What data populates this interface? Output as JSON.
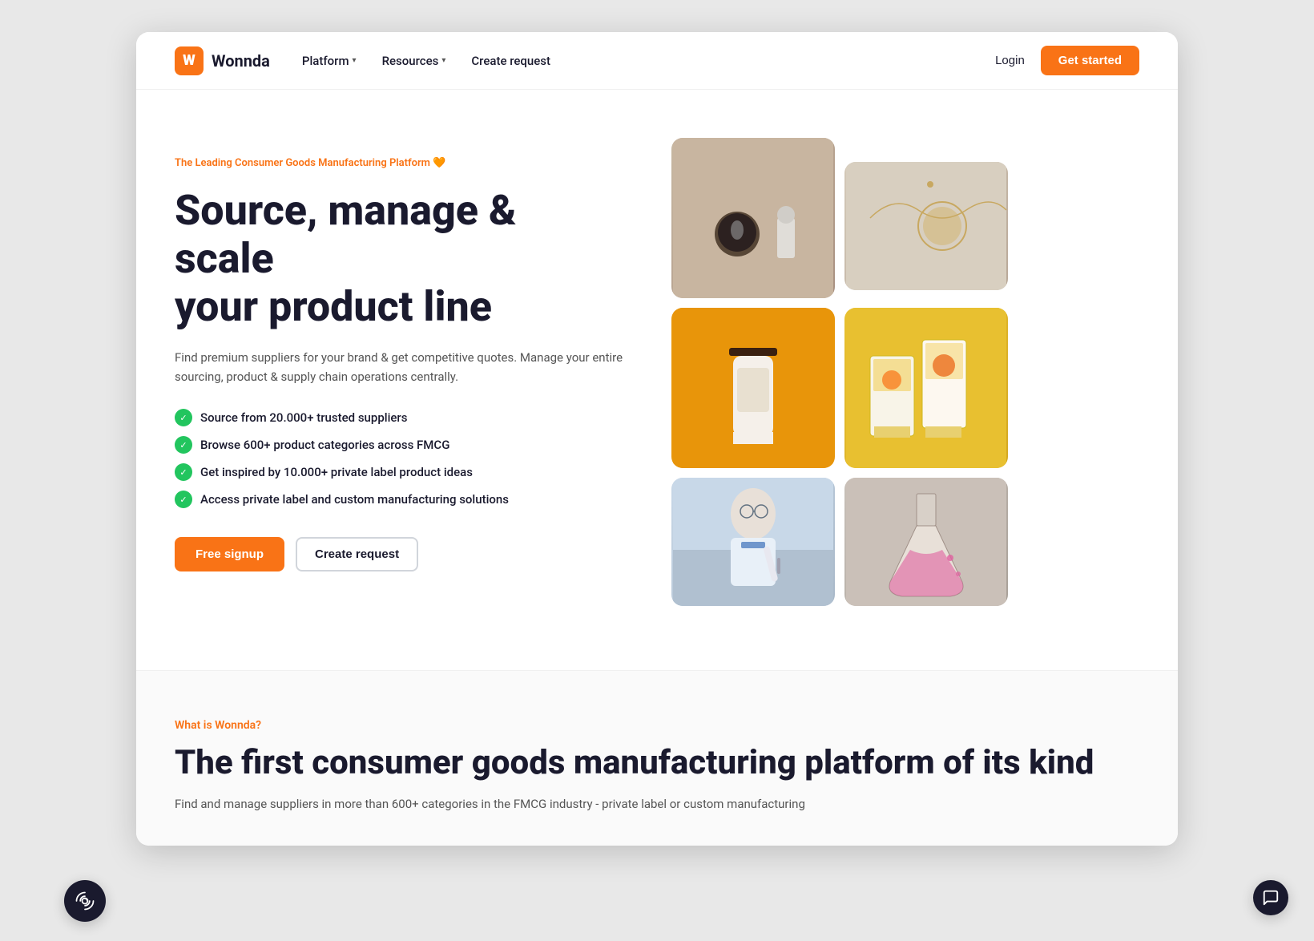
{
  "brand": {
    "logo_letter": "W",
    "name": "Wonnda"
  },
  "navbar": {
    "platform_label": "Platform",
    "resources_label": "Resources",
    "create_request_label": "Create request",
    "login_label": "Login",
    "get_started_label": "Get started"
  },
  "hero": {
    "badge_text": "The Leading Consumer Goods Manufacturing Platform 🧡",
    "title_line1": "Source, manage & scale",
    "title_line2": "your product line",
    "subtitle": "Find premium suppliers for your brand & get competitive quotes. Manage your entire sourcing, product & supply chain operations centrally.",
    "features": [
      "Source from 20.000+ trusted suppliers",
      "Browse 600+ product categories across FMCG",
      "Get inspired by 10.000+ private label product ideas",
      "Access private label and custom manufacturing solutions"
    ],
    "cta_primary": "Free signup",
    "cta_secondary": "Create request"
  },
  "second_section": {
    "badge": "What is Wonnda?",
    "title": "The first consumer goods manufacturing platform of its kind",
    "description": "Find and manage suppliers in more than 600+ categories in the FMCG industry - private label or custom manufacturing"
  },
  "images": {
    "img1_alt": "cosmetics products",
    "img2_alt": "jewelry necklace",
    "img3_alt": "supplement bottle",
    "img4_alt": "food packaging",
    "img5_alt": "lab scientist",
    "img6_alt": "chemistry flask"
  },
  "chat": {
    "icon": "💬"
  }
}
